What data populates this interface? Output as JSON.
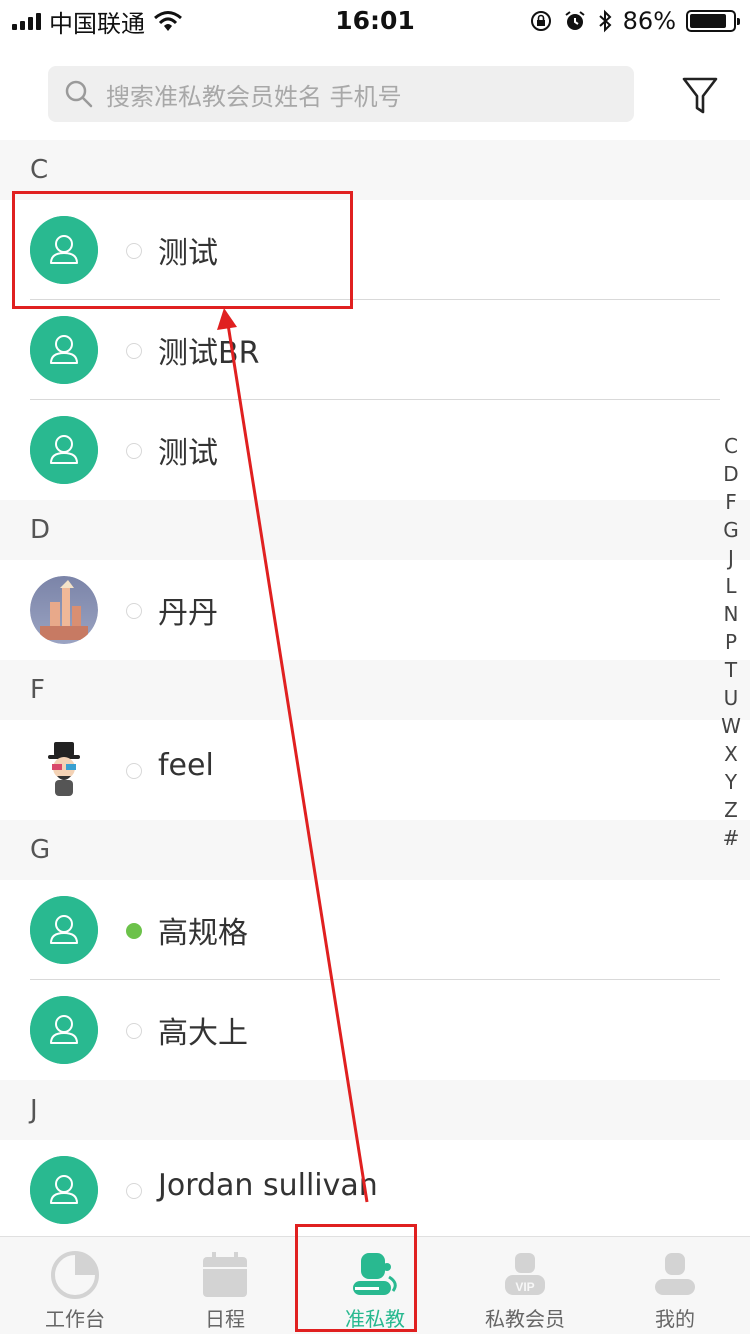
{
  "status_bar": {
    "carrier": "中国联通",
    "time": "16:01",
    "battery_percent": "86%",
    "battery_level": 0.86
  },
  "search": {
    "placeholder": "搜索准私教会员姓名 手机号"
  },
  "sections": [
    {
      "letter": "C",
      "rows": [
        {
          "name": "测试",
          "avatar": "default-user-icon",
          "online": false
        },
        {
          "name": "测试BR",
          "avatar": "default-user-icon",
          "online": false
        },
        {
          "name": "测试",
          "avatar": "default-user-icon",
          "online": false
        }
      ]
    },
    {
      "letter": "D",
      "rows": [
        {
          "name": "丹丹",
          "avatar": "photo-avatar",
          "online": false
        }
      ]
    },
    {
      "letter": "F",
      "rows": [
        {
          "name": "feel",
          "avatar": "cartoon-avatar",
          "online": false
        }
      ]
    },
    {
      "letter": "G",
      "rows": [
        {
          "name": "高规格",
          "avatar": "default-user-icon",
          "online": true
        },
        {
          "name": "高大上",
          "avatar": "default-user-icon",
          "online": false
        }
      ]
    },
    {
      "letter": "J",
      "rows": [
        {
          "name": "Jordan sullivan",
          "avatar": "default-user-icon",
          "online": false
        }
      ]
    }
  ],
  "index_letters": [
    "C",
    "D",
    "F",
    "G",
    "J",
    "L",
    "N",
    "P",
    "T",
    "U",
    "W",
    "X",
    "Y",
    "Z",
    "#"
  ],
  "tabs": [
    {
      "label": "工作台",
      "icon": "pie-chart-icon",
      "active": false
    },
    {
      "label": "日程",
      "icon": "calendar-icon",
      "active": false
    },
    {
      "label": "准私教",
      "icon": "prospect-members-icon",
      "active": true
    },
    {
      "label": "私教会员",
      "icon": "vip-member-icon",
      "active": false
    },
    {
      "label": "我的",
      "icon": "profile-icon",
      "active": false
    }
  ],
  "colors": {
    "accent": "#29b990",
    "online": "#6cc24a",
    "annotation": "#e02020"
  }
}
